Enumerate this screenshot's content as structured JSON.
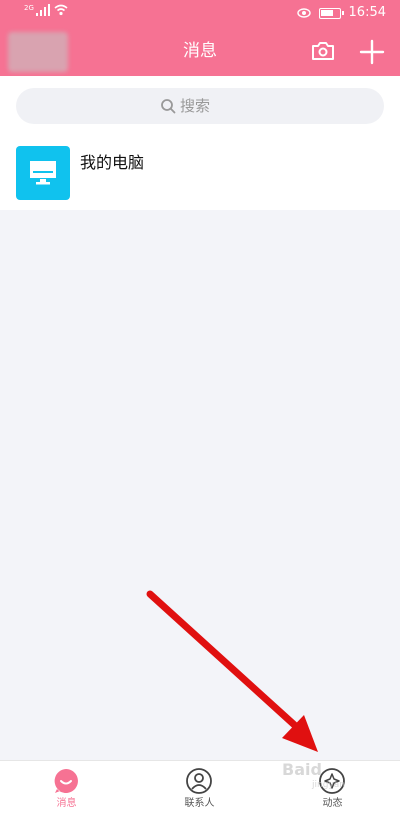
{
  "statusbar": {
    "network": "2G",
    "time": "16:54"
  },
  "header": {
    "title": "消息"
  },
  "search": {
    "placeholder": "搜索"
  },
  "conversations": [
    {
      "title": "我的电脑",
      "icon": "computer-icon"
    }
  ],
  "tabs": [
    {
      "label": "消息",
      "icon": "message-bubble-icon",
      "active": true
    },
    {
      "label": "联系人",
      "icon": "contacts-icon",
      "active": false
    },
    {
      "label": "动态",
      "icon": "star-compass-icon",
      "active": false
    }
  ],
  "watermark": {
    "text": "Baid",
    "sub": "jingyan"
  },
  "colors": {
    "brand": "#f67293",
    "pc_icon": "#10c2ee",
    "arrow": "#e01010"
  }
}
